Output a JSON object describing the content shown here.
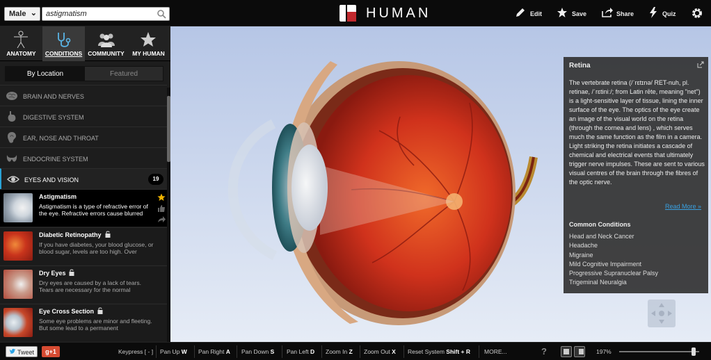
{
  "topbar": {
    "gender": "Male",
    "search_value": "astigmatism",
    "logo_text": "HUMAN",
    "actions": {
      "edit": "Edit",
      "save": "Save",
      "share": "Share",
      "quiz": "Quiz"
    }
  },
  "sidebar": {
    "tabs": [
      {
        "label": "ANATOMY",
        "icon": "human-figure-icon"
      },
      {
        "label": "CONDITIONS",
        "icon": "stethoscope-icon"
      },
      {
        "label": "COMMUNITY",
        "icon": "community-icon"
      },
      {
        "label": "MY HUMAN",
        "icon": "star-icon"
      }
    ],
    "active_tab": "CONDITIONS",
    "segments": {
      "by_location": "By Location",
      "featured": "Featured"
    },
    "categories": [
      {
        "label": "BRAIN AND NERVES",
        "icon": "brain-icon"
      },
      {
        "label": "DIGESTIVE SYSTEM",
        "icon": "stomach-icon"
      },
      {
        "label": "EAR, NOSE AND THROAT",
        "icon": "ear-icon"
      },
      {
        "label": "ENDOCRINE SYSTEM",
        "icon": "thyroid-icon"
      },
      {
        "label": "EYES AND VISION",
        "icon": "eye-icon",
        "count": "19"
      }
    ],
    "conditions": [
      {
        "title": "Astigmatism",
        "desc": "Astigmatism is a type of refractive error of the eye. Refractive errors cause blurred"
      },
      {
        "title": "Diabetic Retinopathy",
        "desc": "If you have diabetes, your blood glucose, or blood sugar, levels are too high. Over"
      },
      {
        "title": "Dry Eyes",
        "desc": "Dry eyes are caused by a lack of tears. Tears are necessary for the normal"
      },
      {
        "title": "Eye Cross Section",
        "desc": "Some eye problems are minor and fleeting. But some lead to a permanent"
      }
    ]
  },
  "info": {
    "title": "Retina",
    "text": "The vertebrate retina (/ˈrɛtɪnə/ RET-nuh, pl. retinae, /ˈrɛtiniː/; from Latin rēte, meaning \"net\") is a light-sensitive layer of tissue, lining the inner surface of the eye. The optics of the eye create an image of the visual world on the retina (through the cornea and lens) , which serves much the same function as the film in a camera. Light striking the retina initiates a cascade of chemical and electrical events that ultimately trigger nerve impulses. These are sent to various visual centres of the brain through the fibres of the optic nerve.",
    "read_more": "Read More »",
    "common_heading": "Common Conditions",
    "common": [
      "Head and Neck Cancer",
      "Headache",
      "Migraine",
      "Mild Cognitive Impairment",
      "Progressive Supranuclear Palsy",
      "Trigeminal Neuralgia"
    ]
  },
  "bottombar": {
    "tweet": "Tweet",
    "gplus": "g+1",
    "keypress": "Keypress [ - ]",
    "shortcuts": [
      {
        "label": "Pan Up",
        "key": "W"
      },
      {
        "label": "Pan Right",
        "key": "A"
      },
      {
        "label": "Pan Down",
        "key": "S"
      },
      {
        "label": "Pan Left",
        "key": "D"
      },
      {
        "label": "Zoom In",
        "key": "Z"
      },
      {
        "label": "Zoom Out",
        "key": "X"
      },
      {
        "label": "Reset System",
        "key": "Shift + R"
      }
    ],
    "more": "MORE...",
    "help": "?",
    "zoom": "197%",
    "zoom_level_fraction": 0.93
  },
  "colors": {
    "accent": "#29a3d6",
    "brand_red": "#c0282d",
    "star": "#f0b400"
  }
}
